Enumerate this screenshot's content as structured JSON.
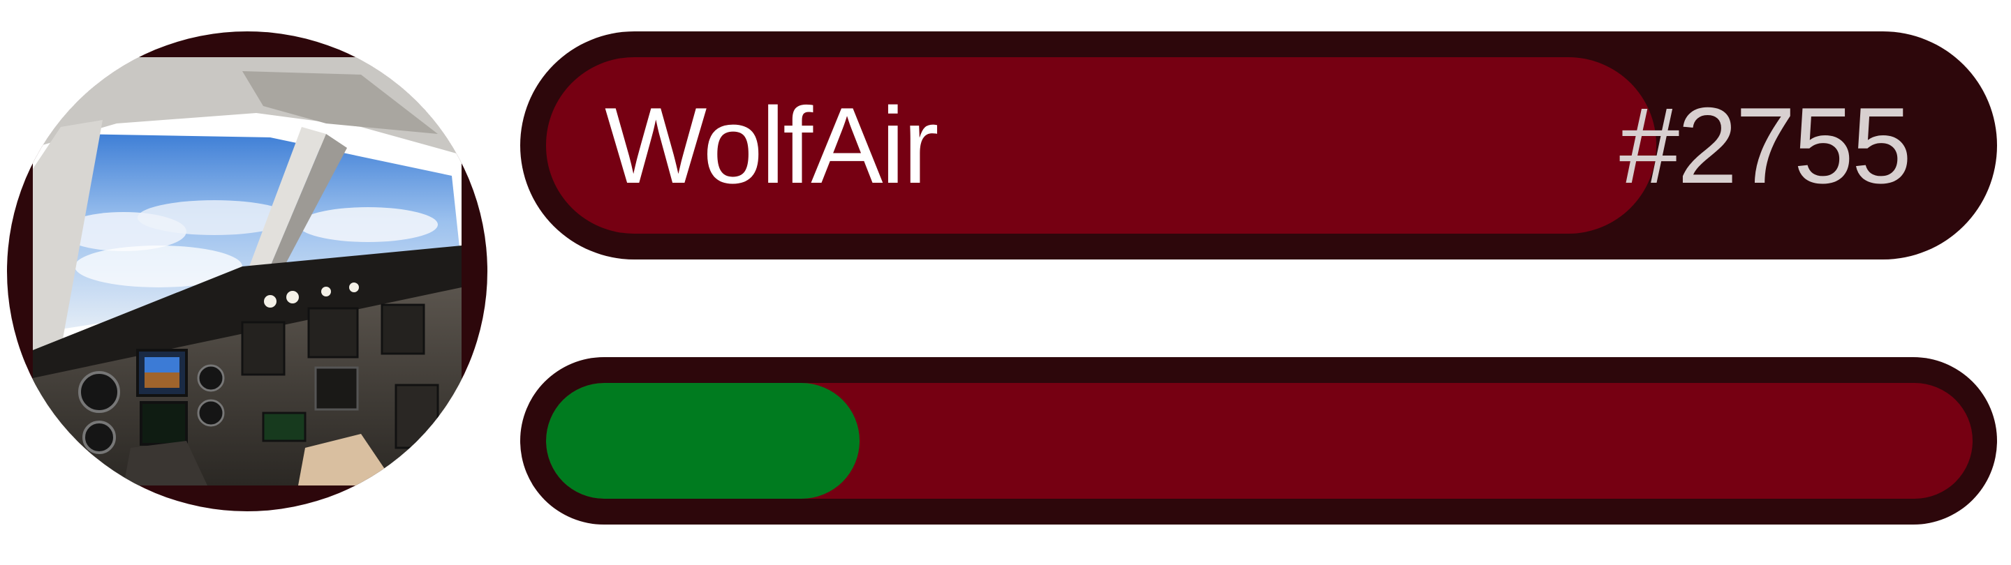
{
  "profile": {
    "avatar_icon": "cockpit-photo-icon",
    "name": "WolfAir",
    "id": "#2755"
  },
  "progress": {
    "fraction": 0.22
  },
  "colors": {
    "border": "#2d070b",
    "primary": "#760012",
    "progress": "#007b1f",
    "name_text": "#ffffff",
    "id_text": "#d8d0d0"
  }
}
